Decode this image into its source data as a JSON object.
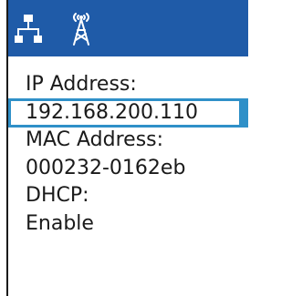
{
  "header": {
    "icons": [
      "network-icon",
      "wireless-antenna-icon"
    ],
    "background_color": "#1f5ba8",
    "icon_color": "#ffffff"
  },
  "network_info": {
    "ip_label": "IP Address:",
    "ip_value": "192.168.200.110",
    "mac_label": "MAC Address:",
    "mac_value": "000232-0162eb",
    "dhcp_label": "DHCP:",
    "dhcp_value": "Enable"
  },
  "selection": {
    "highlight_color": "#2f90c8",
    "selected_item": "ip_value"
  }
}
